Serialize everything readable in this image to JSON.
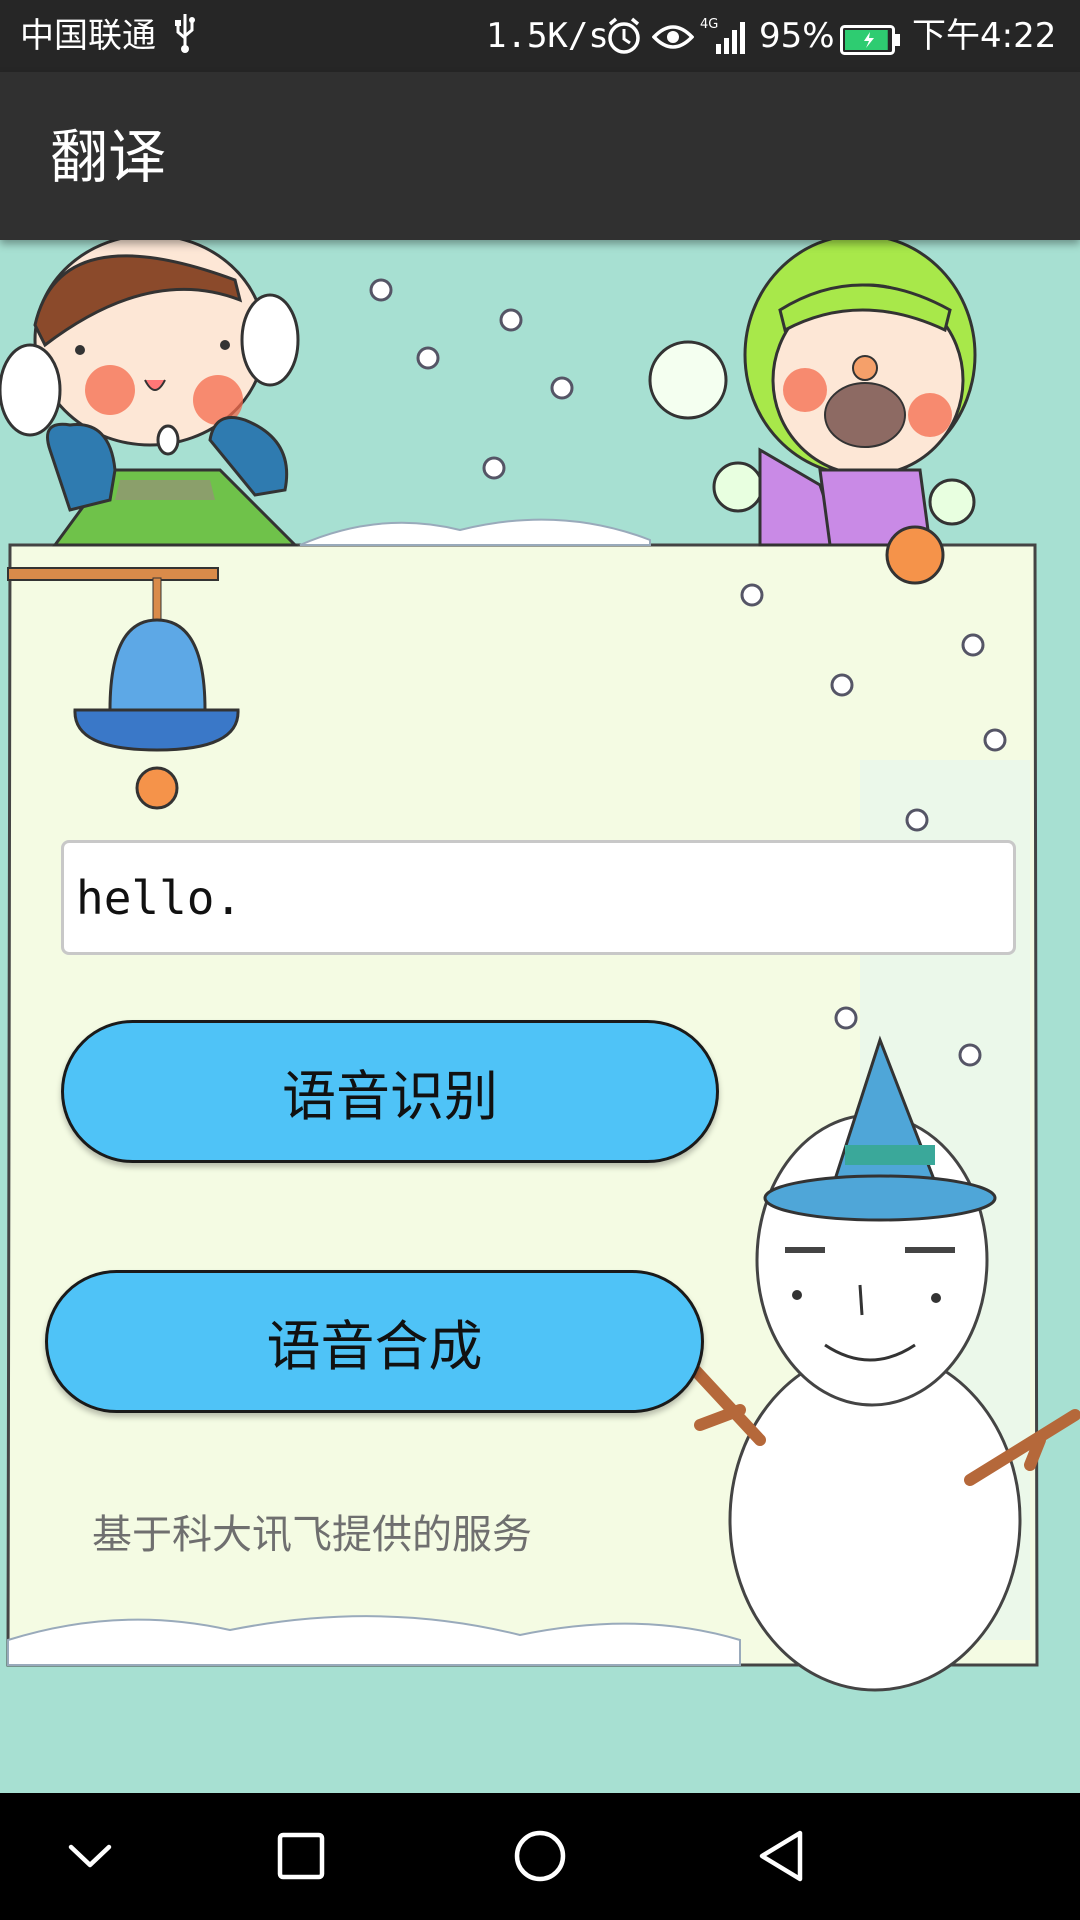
{
  "status_bar": {
    "carrier": "中国联通",
    "usb_icon": "usb-icon",
    "net_speed": "1.5K/s",
    "alarm_icon": "alarm-icon",
    "eye_icon": "eye-icon",
    "signal": "4G",
    "battery_percent": "95%",
    "battery_level": 0.95,
    "time": "下午4:22"
  },
  "app_bar": {
    "title": "翻译"
  },
  "main": {
    "input_value": "hello.",
    "recognize_button": "语音识别",
    "synthesize_button": "语音合成",
    "footer_note": "基于科大讯飞提供的服务"
  },
  "colors": {
    "button_blue": "#4fc3f7",
    "background_teal": "#a7e0d2",
    "paper": "#f4fbe3"
  },
  "nav_bar": {
    "back_icon": "chevron-down-icon",
    "recents_icon": "square-icon",
    "home_icon": "circle-icon",
    "triangle_icon": "triangle-back-icon"
  }
}
